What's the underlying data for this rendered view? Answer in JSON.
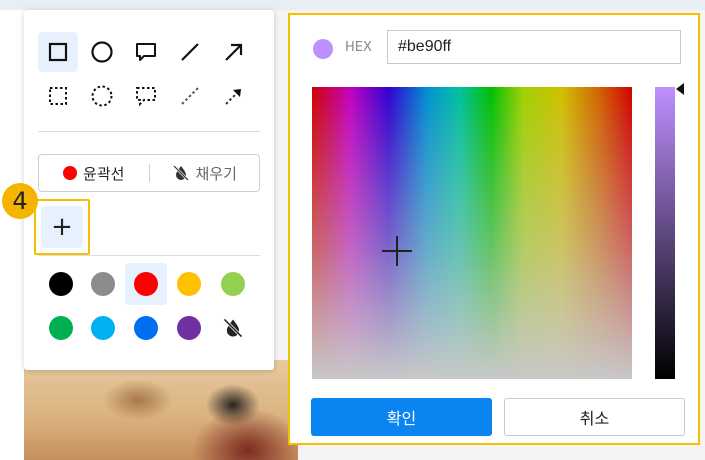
{
  "badge": {
    "number": "4"
  },
  "shape_tools": {
    "solid": [
      "rectangle-icon",
      "circle-icon",
      "speech-bubble-icon",
      "line-icon",
      "arrow-icon"
    ],
    "dashed": [
      "dashed-rectangle-icon",
      "dashed-circle-icon",
      "dashed-speech-bubble-icon",
      "dashed-line-icon",
      "dashed-arrow-icon"
    ],
    "selected": "rectangle-icon"
  },
  "style_toggle": {
    "outline_label": "윤곽선",
    "outline_color": "#ff0000",
    "fill_label": "채우기",
    "fill_icon": "no-fill-icon"
  },
  "add_color": {
    "label": "+"
  },
  "swatches": [
    {
      "color": "#000000"
    },
    {
      "color": "#8c8c8c"
    },
    {
      "color": "#ff0000",
      "selected": true
    },
    {
      "color": "#ffc000"
    },
    {
      "color": "#92d050"
    },
    {
      "color": "#00b050"
    },
    {
      "color": "#00b0f0"
    },
    {
      "color": "#0070f0"
    },
    {
      "color": "#7030a0"
    },
    {
      "color": "none",
      "icon": "no-fill-icon"
    }
  ],
  "picker": {
    "hex_label": "HEX",
    "hex_value": "#be90ff",
    "current_color": "#be90ff",
    "confirm_label": "확인",
    "cancel_label": "취소"
  },
  "accent": "#f5c000"
}
